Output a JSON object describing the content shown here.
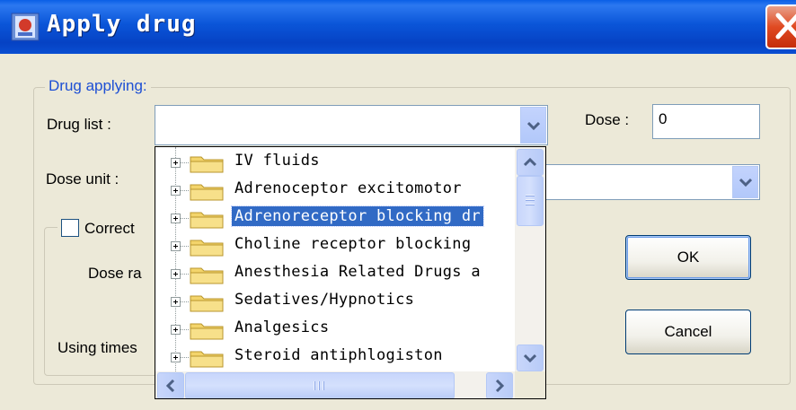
{
  "window": {
    "title": "Apply drug",
    "close_icon": "close-x-icon",
    "accent_color": "#0a55d8"
  },
  "group": {
    "title": "Drug applying:"
  },
  "form": {
    "drug_list_label": "Drug list :",
    "dose_label": "Dose :",
    "dose_value": "0",
    "dose_unit_label": "Dose unit :",
    "correct_label": "Correct",
    "dose_rate_label": "Dose ra",
    "using_times_label": "Using times"
  },
  "buttons": {
    "ok": "OK",
    "cancel": "Cancel"
  },
  "drug_tree": {
    "items": [
      {
        "label": "IV fluids",
        "selected": false
      },
      {
        "label": "Adrenoceptor excitomotor",
        "selected": false
      },
      {
        "label": "Adrenoreceptor blocking dr",
        "selected": true
      },
      {
        "label": "Choline receptor blocking",
        "selected": false
      },
      {
        "label": "Anesthesia Related Drugs a",
        "selected": false
      },
      {
        "label": "Sedatives/Hypnotics",
        "selected": false
      },
      {
        "label": "Analgesics",
        "selected": false
      },
      {
        "label": "Steroid antiphlogiston",
        "selected": false
      }
    ],
    "selection_color": "#316ac5"
  }
}
